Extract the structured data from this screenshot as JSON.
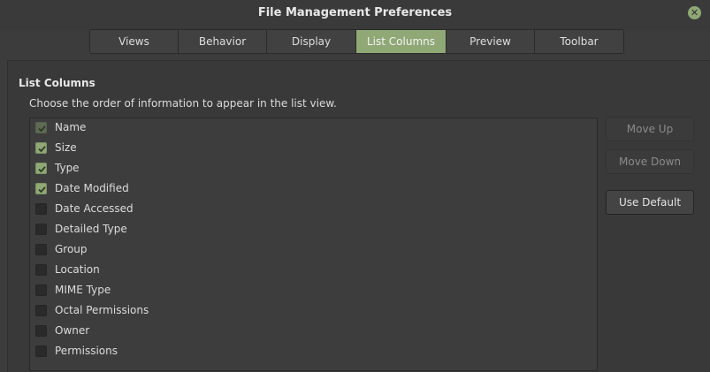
{
  "window": {
    "title": "File Management Preferences",
    "close_glyph": "✕"
  },
  "tabs": [
    {
      "label": "Views",
      "active": false
    },
    {
      "label": "Behavior",
      "active": false
    },
    {
      "label": "Display",
      "active": false
    },
    {
      "label": "List Columns",
      "active": true
    },
    {
      "label": "Preview",
      "active": false
    },
    {
      "label": "Toolbar",
      "active": false
    }
  ],
  "section": {
    "title": "List Columns",
    "description": "Choose the order of information to appear in the list view."
  },
  "columns": [
    {
      "label": "Name",
      "checked": true,
      "disabled": true
    },
    {
      "label": "Size",
      "checked": true,
      "disabled": false
    },
    {
      "label": "Type",
      "checked": true,
      "disabled": false
    },
    {
      "label": "Date Modified",
      "checked": true,
      "disabled": false
    },
    {
      "label": "Date Accessed",
      "checked": false,
      "disabled": false
    },
    {
      "label": "Detailed Type",
      "checked": false,
      "disabled": false
    },
    {
      "label": "Group",
      "checked": false,
      "disabled": false
    },
    {
      "label": "Location",
      "checked": false,
      "disabled": false
    },
    {
      "label": "MIME Type",
      "checked": false,
      "disabled": false
    },
    {
      "label": "Octal Permissions",
      "checked": false,
      "disabled": false
    },
    {
      "label": "Owner",
      "checked": false,
      "disabled": false
    },
    {
      "label": "Permissions",
      "checked": false,
      "disabled": false
    }
  ],
  "buttons": {
    "move_up": "Move Up",
    "move_down": "Move Down",
    "use_default": "Use Default"
  },
  "colors": {
    "accent": "#8fa876",
    "background": "#3c3c3c"
  }
}
